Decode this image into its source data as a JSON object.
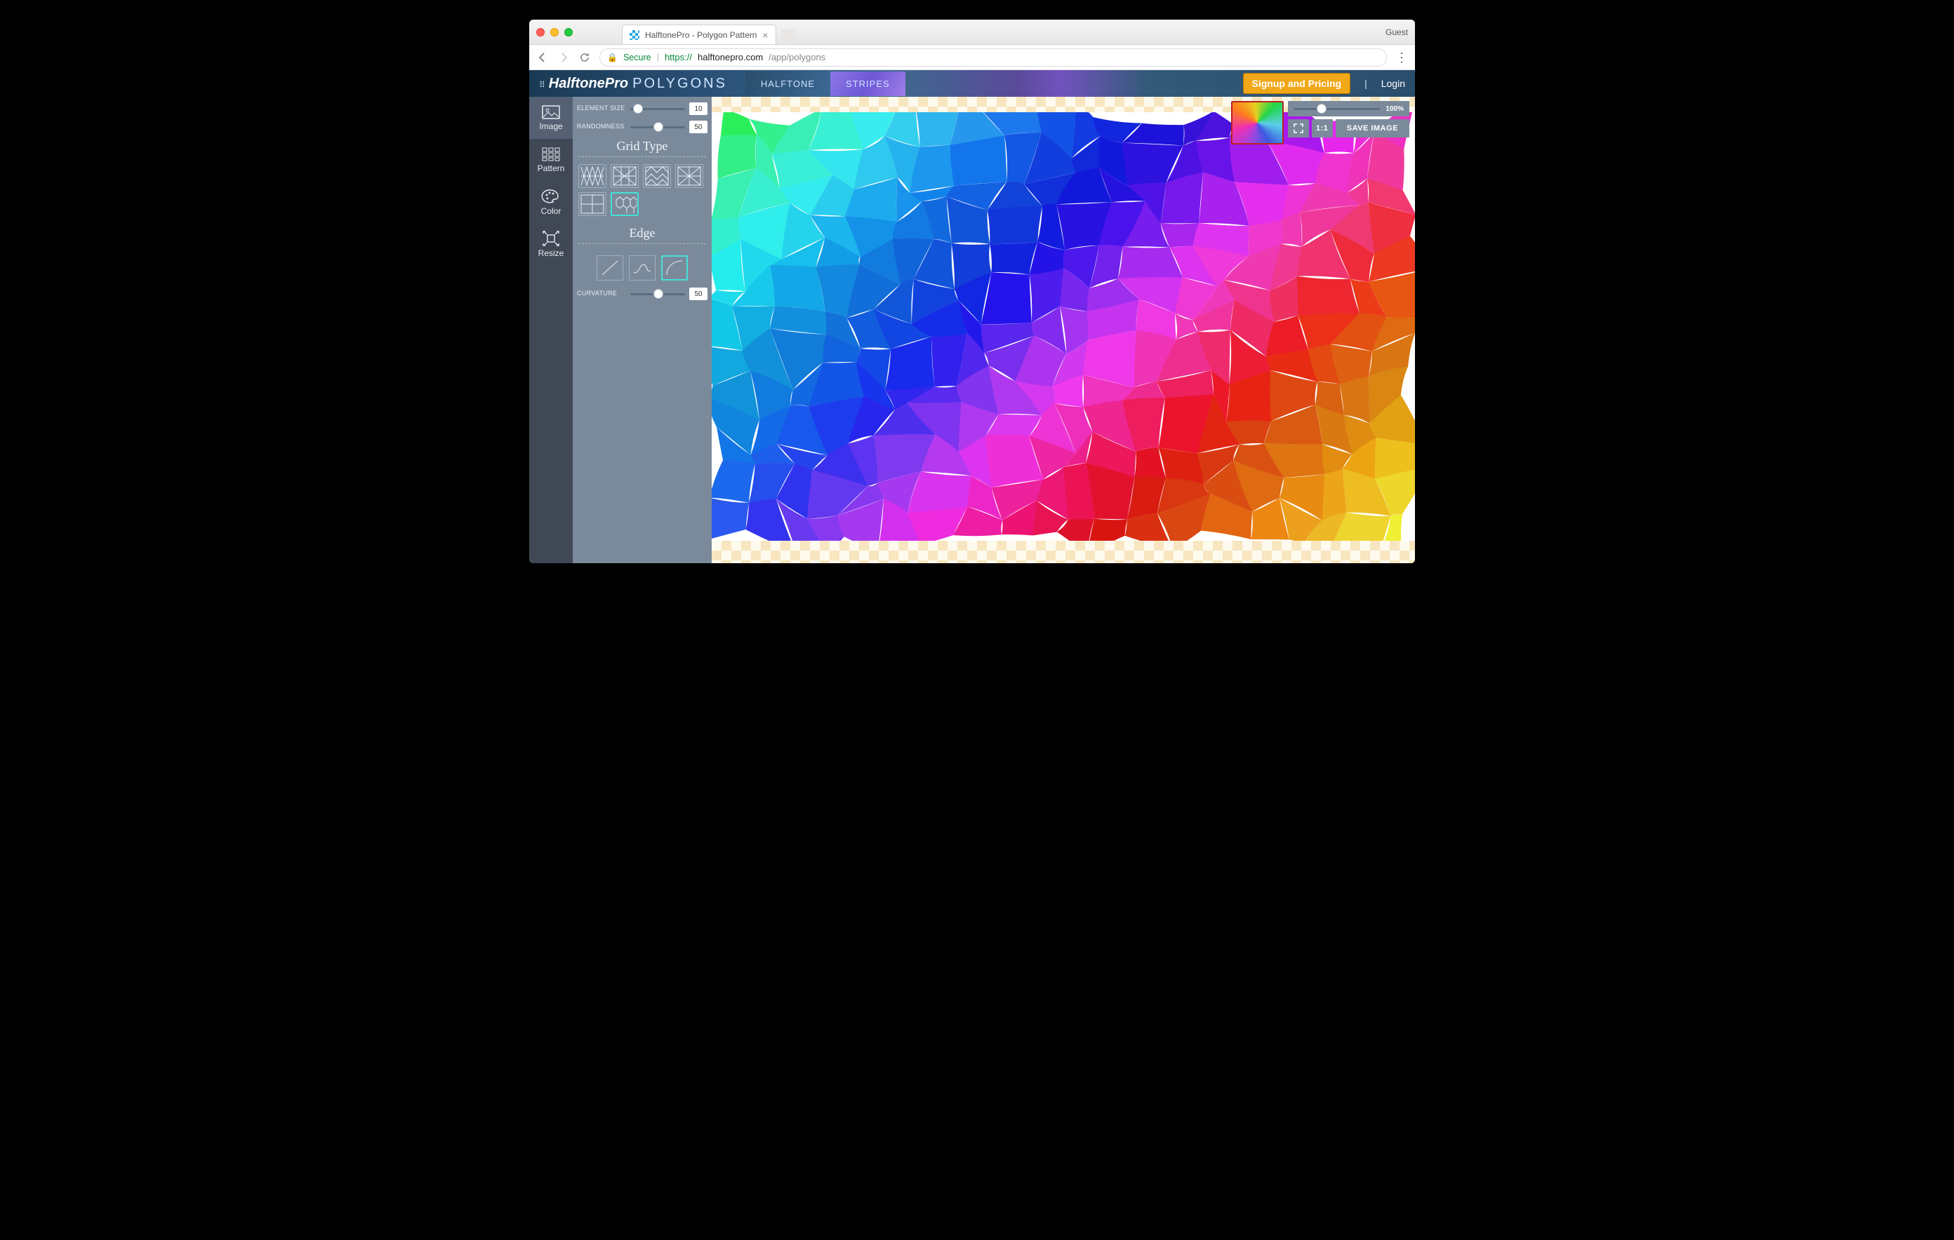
{
  "window": {
    "tab_title": "HalftonePro - Polygon Pattern",
    "guest_label": "Guest"
  },
  "browser": {
    "secure_label": "Secure",
    "url_proto": "https://",
    "url_host": "halftonepro.com",
    "url_path": "/app/polygons"
  },
  "header": {
    "brand_main": "HalftonePro",
    "brand_sub": "POLYGONS",
    "nav_halftone": "HALFTONE",
    "nav_stripes": "STRIPES",
    "cta": "Signup and Pricing",
    "login": "Login"
  },
  "rail": {
    "image": "Image",
    "pattern": "Pattern",
    "color": "Color",
    "resize": "Resize"
  },
  "panel": {
    "element_size_label": "ELEMENT SIZE",
    "element_size_value": "10",
    "randomness_label": "RANDOMNESS",
    "randomness_value": "50",
    "grid_type_title": "Grid Type",
    "edge_title": "Edge",
    "curvature_label": "CURVATURE",
    "curvature_value": "50"
  },
  "overlay": {
    "zoom_pct": "100%",
    "one_to_one": "1:1",
    "save": "SAVE IMAGE"
  }
}
